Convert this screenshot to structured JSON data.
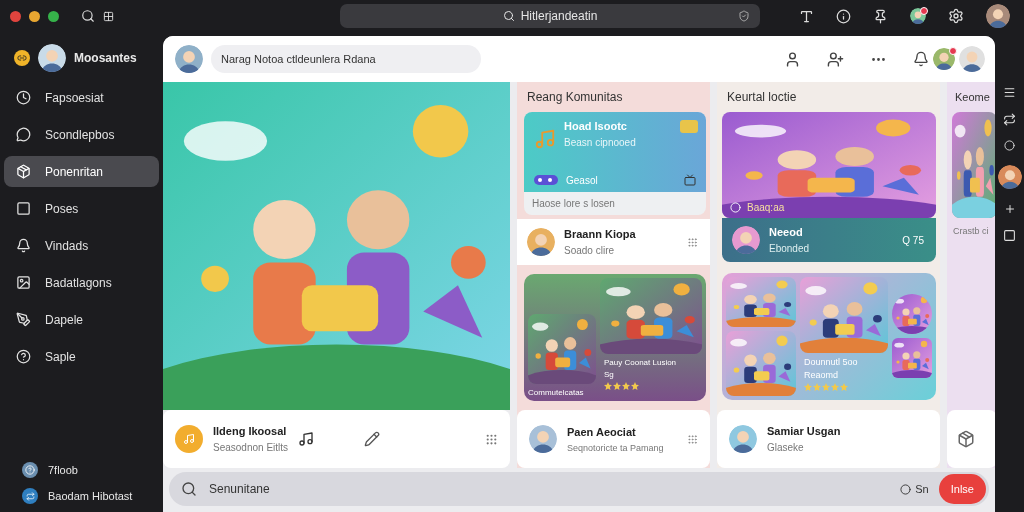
{
  "toolbar": {
    "search": {
      "value": "Hitlerjandeatin"
    }
  },
  "sidebar": {
    "profile": {
      "name": "Moosantes"
    },
    "items": [
      {
        "label": "Fapsoesiat",
        "selected": false
      },
      {
        "label": "Scondlepbos",
        "selected": false
      },
      {
        "label": "Ponenritan",
        "selected": true
      },
      {
        "label": "Poses",
        "selected": false
      },
      {
        "label": "Vindads",
        "selected": false
      },
      {
        "label": "Badatlagons",
        "selected": false
      },
      {
        "label": "Dapele",
        "selected": false
      },
      {
        "label": "Saple",
        "selected": false
      }
    ],
    "footer": [
      {
        "label": "7floob"
      },
      {
        "label": "Baodam Hibotast"
      }
    ]
  },
  "header": {
    "status": {
      "placeholder": "Narag Notoa ctldeunlera Rdana"
    }
  },
  "hero": {
    "title": "Ildeng Ikoosal",
    "subtitle": "Seasodnon Eitlts"
  },
  "community": {
    "heading": "Reang Komunitas",
    "feature": {
      "title": "Hoad Isootc",
      "subtitle": "Beasn cipnooed",
      "tag": "Geasol",
      "footer": "Haose lore s losen"
    },
    "member": {
      "name": "Braann Kiopa",
      "subtitle": "Soado clire"
    },
    "showcase": {
      "caption": "Commutelcatas",
      "title": "Pauy Coonat Lusion",
      "meta": "Sg",
      "stars": 4
    },
    "bottom": {
      "name": "Paen Aeociat",
      "subtitle": "Seqnotoricte ta Pamang"
    }
  },
  "events": {
    "heading": "Keurtal loctie",
    "feature": {
      "label": "Baaq:aa"
    },
    "member": {
      "name": "Neeod",
      "subtitle": "Ebonded",
      "count": "Q 75"
    },
    "showcase": {
      "title": "Dounnutl 5oo",
      "meta": "Reaomd",
      "stars": 5
    },
    "bottom": {
      "name": "Samiar Usgan",
      "subtitle": "Glaseke"
    }
  },
  "side_column": {
    "heading": "Keome",
    "caption": "Crastb ci"
  },
  "composer": {
    "placeholder": "Senunitane",
    "option": "Sn",
    "button": "Inlse"
  }
}
